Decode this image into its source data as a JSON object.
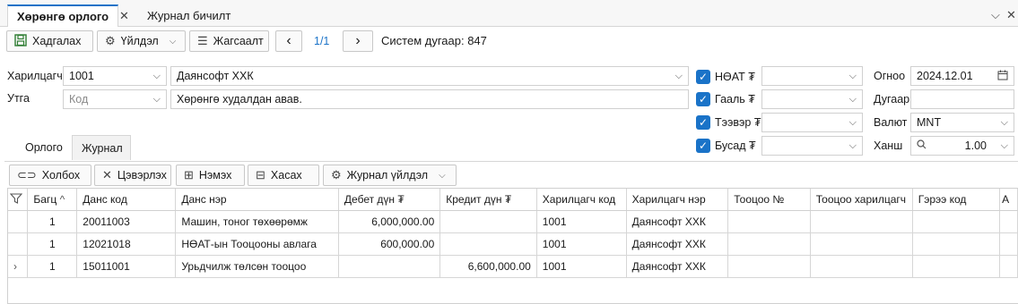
{
  "tabs": [
    {
      "label": "Хөрөнгө орлого",
      "active": true
    },
    {
      "label": "Журнал бичилт",
      "active": false
    }
  ],
  "window_controls": {
    "chevron": "⌵",
    "close": "✕"
  },
  "toolbar": {
    "save": "Хадгалах",
    "actions": "Үйлдэл",
    "sort": "Жагсаалт",
    "page": "1/1",
    "system_number": "Систем дугаар: 847"
  },
  "form": {
    "customer_label": "Харилцагч",
    "customer_code": "1001",
    "customer_name": "Даянсофт ХХК",
    "note_label": "Утга",
    "code_placeholder": "Код",
    "note_value": "Хөрөнгө худалдан авав.",
    "vat_label": "НӨАТ ₮",
    "customs_label": "Гааль ₮",
    "transport_label": "Тээвэр ₮",
    "other_label": "Бусад ₮",
    "date_label": "Огноо",
    "date_value": "2024.12.01",
    "number_label": "Дугаар",
    "currency_label": "Валют",
    "currency_value": "MNT",
    "rate_label": "Ханш",
    "rate_value": "1.00"
  },
  "subtabs": [
    {
      "label": "Орлого",
      "active": false
    },
    {
      "label": "Журнал",
      "active": true
    }
  ],
  "journal_toolbar": {
    "link": "Холбох",
    "clear": "Цэвэрлэх",
    "add": "Нэмэх",
    "remove": "Хасах",
    "journal_actions": "Журнал үйлдэл"
  },
  "grid": {
    "columns": [
      "Багц",
      "Данс код",
      "Данс нэр",
      "Дебет дүн ₮",
      "Кредит дүн ₮",
      "Харилцагч код",
      "Харилцагч нэр",
      "Тооцоо №",
      "Тооцоо харилцагч",
      "Гэрээ код",
      "А"
    ],
    "rows": [
      {
        "marker": "",
        "batch": "1",
        "account_code": "20011003",
        "account_name": "Машин, тоног төхөөрөмж",
        "debit": "6,000,000.00",
        "credit": "",
        "partner_code": "1001",
        "partner_name": "Даянсофт ХХК"
      },
      {
        "marker": "",
        "batch": "1",
        "account_code": "12021018",
        "account_name": "НӨАТ-ын Тооцооны авлага",
        "debit": "600,000.00",
        "credit": "",
        "partner_code": "1001",
        "partner_name": "Даянсофт ХХК"
      },
      {
        "marker": "›",
        "batch": "1",
        "account_code": "15011001",
        "account_name": "Урьдчилж төлсөн тооцоо",
        "debit": "",
        "credit": "6,600,000.00",
        "partner_code": "1001",
        "partner_name": "Даянсофт ХХК"
      }
    ]
  },
  "colors": {
    "accent": "#1a73c8",
    "border": "#d0d0d0"
  }
}
